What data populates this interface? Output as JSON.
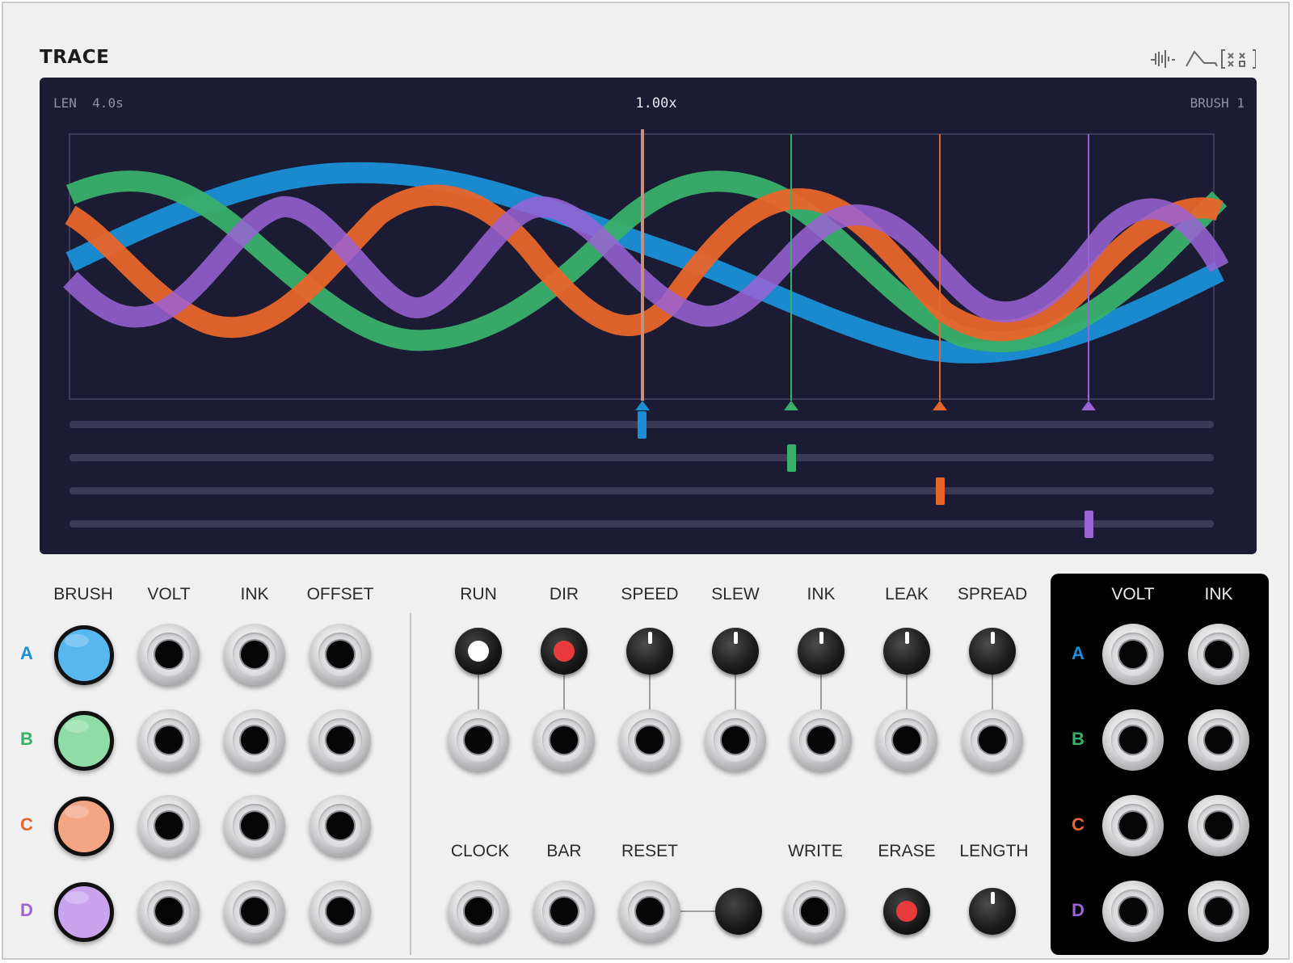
{
  "module": {
    "title": "TRACE",
    "logo_icon": "waveform-envelope-dice-logo"
  },
  "screen": {
    "len_label": "LEN",
    "len_value": "4.0s",
    "speed": "1.00x",
    "brush": "BRUSH 1"
  },
  "colors": {
    "A": "#1a8fd6",
    "B": "#39b06a",
    "C": "#e8652b",
    "D": "#9a63d6",
    "screen_bg": "#1b1b33",
    "panel_bg": "#f0f0f0"
  },
  "tracks": [
    {
      "id": "A",
      "playhead_position": 0.5
    },
    {
      "id": "B",
      "playhead_position": 0.63
    },
    {
      "id": "C",
      "playhead_position": 0.76
    },
    {
      "id": "D",
      "playhead_position": 0.89
    }
  ],
  "left_section": {
    "headers": [
      "BRUSH",
      "VOLT",
      "INK",
      "OFFSET"
    ],
    "rows": [
      "A",
      "B",
      "C",
      "D"
    ],
    "brush_colors": [
      "#57b7ef",
      "#8fdca6",
      "#f4a584",
      "#c9a3ee"
    ]
  },
  "middle_section": {
    "top_headers": [
      "RUN",
      "DIR",
      "SPEED",
      "SLEW",
      "INK",
      "LEAK",
      "SPREAD"
    ],
    "run_light": "#ffffff",
    "dir_light": "#e83a3a",
    "bottom_headers": [
      "CLOCK",
      "BAR",
      "RESET",
      "WRITE",
      "ERASE",
      "LENGTH"
    ],
    "erase_light": "#e83a3a"
  },
  "outputs": {
    "headers": [
      "VOLT",
      "INK"
    ],
    "rows": [
      "A",
      "B",
      "C",
      "D"
    ]
  }
}
